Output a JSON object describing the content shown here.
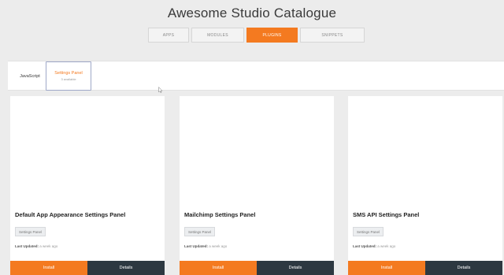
{
  "header": {
    "title": "Awesome Studio Catalogue"
  },
  "tabs": [
    {
      "label": "APPS"
    },
    {
      "label": "MODULES"
    },
    {
      "label": "PLUGINS",
      "active": true
    },
    {
      "label": "SNIPPETS"
    }
  ],
  "filters": [
    {
      "label": "JavaScript"
    },
    {
      "label": "Settings Panel",
      "sub": "3 available"
    }
  ],
  "cards": [
    {
      "name": "Default App Appearance Settings Panel",
      "tag": "Settings Panel",
      "updated_label": "Last Updated:",
      "updated_value": "a week ago",
      "install": "Install",
      "details": "Details"
    },
    {
      "name": "Mailchimp Settings Panel",
      "tag": "Settings Panel",
      "updated_label": "Last Updated:",
      "updated_value": "a week ago",
      "install": "Install",
      "details": "Details"
    },
    {
      "name": "SMS API Settings Panel",
      "tag": "Settings Panel",
      "updated_label": "Last Updated:",
      "updated_value": "a week ago",
      "install": "Install",
      "details": "Details"
    }
  ],
  "colors": {
    "accent": "#f47a20",
    "dark": "#2d3841",
    "background": "#ececec"
  }
}
